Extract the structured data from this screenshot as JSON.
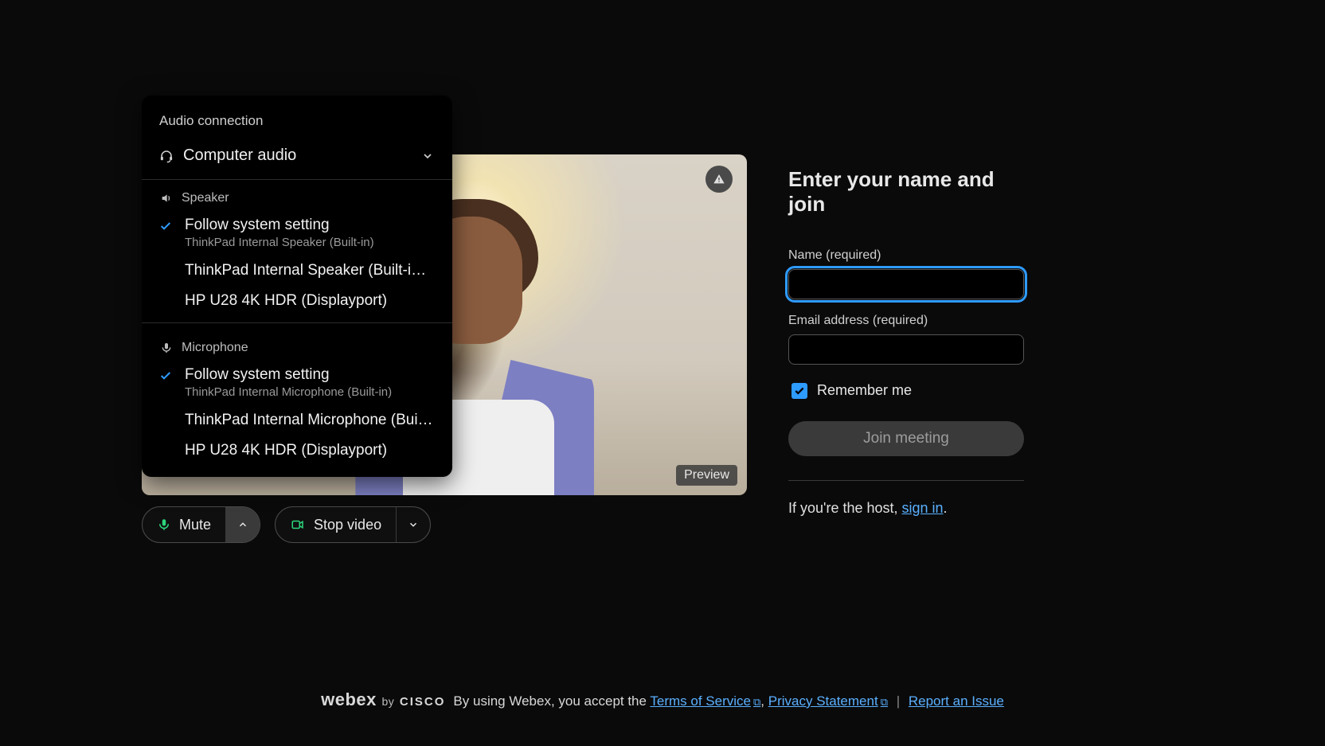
{
  "audio_panel": {
    "title": "Audio connection",
    "mode_label": "Computer audio",
    "speaker": {
      "section_label": "Speaker",
      "options": [
        {
          "primary": "Follow system setting",
          "secondary": "ThinkPad Internal Speaker (Built-in)",
          "selected": true
        },
        {
          "primary": "ThinkPad Internal Speaker (Built-i…",
          "secondary": "",
          "selected": false
        },
        {
          "primary": "HP U28 4K HDR (Displayport)",
          "secondary": "",
          "selected": false
        }
      ]
    },
    "microphone": {
      "section_label": "Microphone",
      "options": [
        {
          "primary": "Follow system setting",
          "secondary": "ThinkPad Internal Microphone (Built-in)",
          "selected": true
        },
        {
          "primary": "ThinkPad Internal Microphone (Bui…",
          "secondary": "",
          "selected": false
        },
        {
          "primary": "HP U28 4K HDR (Displayport)",
          "secondary": "",
          "selected": false
        }
      ]
    }
  },
  "video": {
    "preview_label": "Preview"
  },
  "controls": {
    "mute_label": "Mute",
    "stop_video_label": "Stop video"
  },
  "form": {
    "heading": "Enter your name and join",
    "name_label": "Name (required)",
    "name_value": "",
    "email_label": "Email address (required)",
    "email_value": "",
    "remember_label": "Remember me",
    "remember_checked": true,
    "join_label": "Join meeting",
    "host_prefix": "If you're the host, ",
    "host_link": "sign in",
    "host_suffix": "."
  },
  "footer": {
    "brand_main": "webex",
    "brand_by": "by",
    "brand_cisco": "CISCO",
    "accept_prefix": "By using Webex, you accept the ",
    "tos": "Terms of Service",
    "comma": ", ",
    "privacy": "Privacy Statement",
    "report": "Report an Issue"
  }
}
